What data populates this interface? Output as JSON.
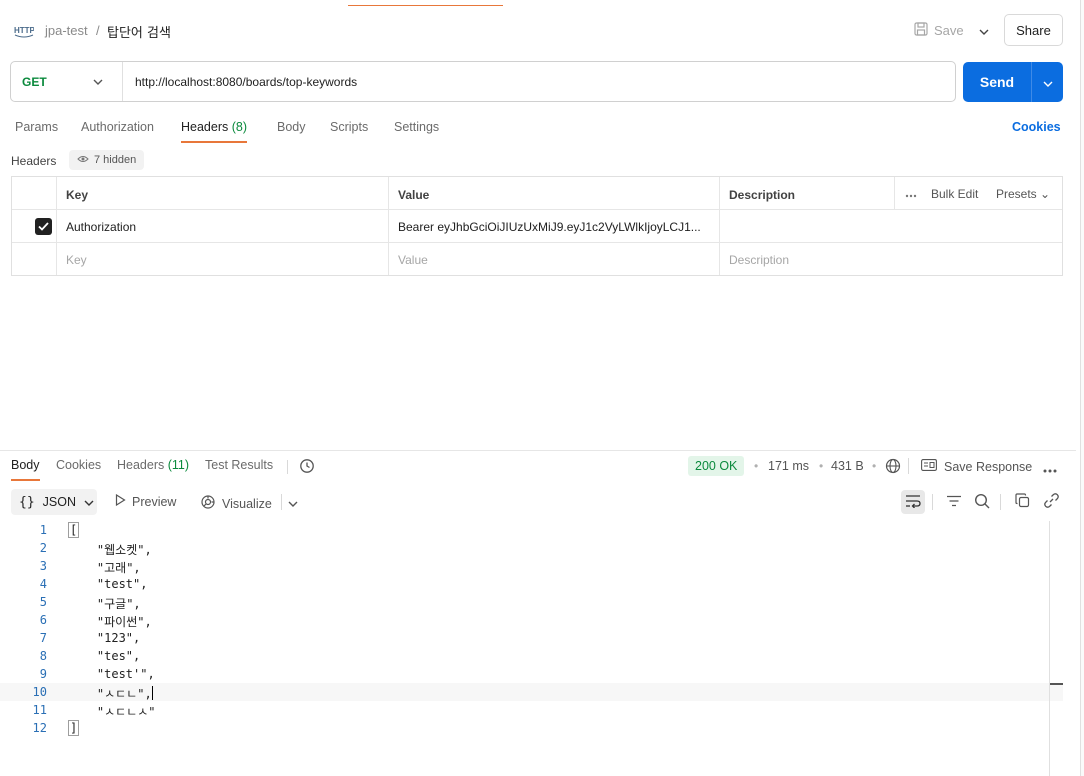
{
  "header": {
    "collection": "jpa-test",
    "separator": "/",
    "request_name": "탑단어 검색",
    "save_label": "Save",
    "share_label": "Share"
  },
  "request": {
    "method": "GET",
    "url": "http://localhost:8080/boards/top-keywords",
    "send_label": "Send"
  },
  "request_tabs": [
    {
      "label": "Params"
    },
    {
      "label": "Authorization"
    },
    {
      "label": "Headers",
      "count": "(8)"
    },
    {
      "label": "Body"
    },
    {
      "label": "Scripts"
    },
    {
      "label": "Settings"
    }
  ],
  "cookies_label": "Cookies",
  "headers_section": {
    "label": "Headers",
    "hidden_label": "7 hidden",
    "columns": {
      "key": "Key",
      "value": "Value",
      "description": "Description"
    },
    "bulk_edit": "Bulk Edit",
    "presets": "Presets",
    "rows": [
      {
        "key": "Authorization",
        "value": "Bearer eyJhbGciOiJIUzUxMiJ9.eyJ1c2VyLWlkIjoyLCJ1...",
        "description": ""
      }
    ],
    "placeholders": {
      "key": "Key",
      "value": "Value",
      "description": "Description"
    }
  },
  "response_tabs": [
    {
      "label": "Body"
    },
    {
      "label": "Cookies"
    },
    {
      "label": "Headers",
      "count": "(11)"
    },
    {
      "label": "Test Results"
    }
  ],
  "response_meta": {
    "status": "200 OK",
    "time": "171 ms",
    "size": "431 B",
    "save_response": "Save Response"
  },
  "response_toolbar": {
    "format": "JSON",
    "preview": "Preview",
    "visualize": "Visualize"
  },
  "code_lines": [
    {
      "n": "1",
      "text": "["
    },
    {
      "n": "2",
      "text": "    \"웹소켓\","
    },
    {
      "n": "3",
      "text": "    \"고래\","
    },
    {
      "n": "4",
      "text": "    \"test\","
    },
    {
      "n": "5",
      "text": "    \"구글\","
    },
    {
      "n": "6",
      "text": "    \"파이썬\","
    },
    {
      "n": "7",
      "text": "    \"123\","
    },
    {
      "n": "8",
      "text": "    \"tes\","
    },
    {
      "n": "9",
      "text": "    \"test'\","
    },
    {
      "n": "10",
      "text": "    \"ㅅㄷㄴ\","
    },
    {
      "n": "11",
      "text": "    \"ㅅㄷㄴㅅ\""
    },
    {
      "n": "12",
      "text": "]"
    }
  ],
  "colors": {
    "accent": "#e8773a",
    "primary": "#0b6de0",
    "method_get": "#0b8a3d",
    "status_ok": "#0b8a3d"
  }
}
